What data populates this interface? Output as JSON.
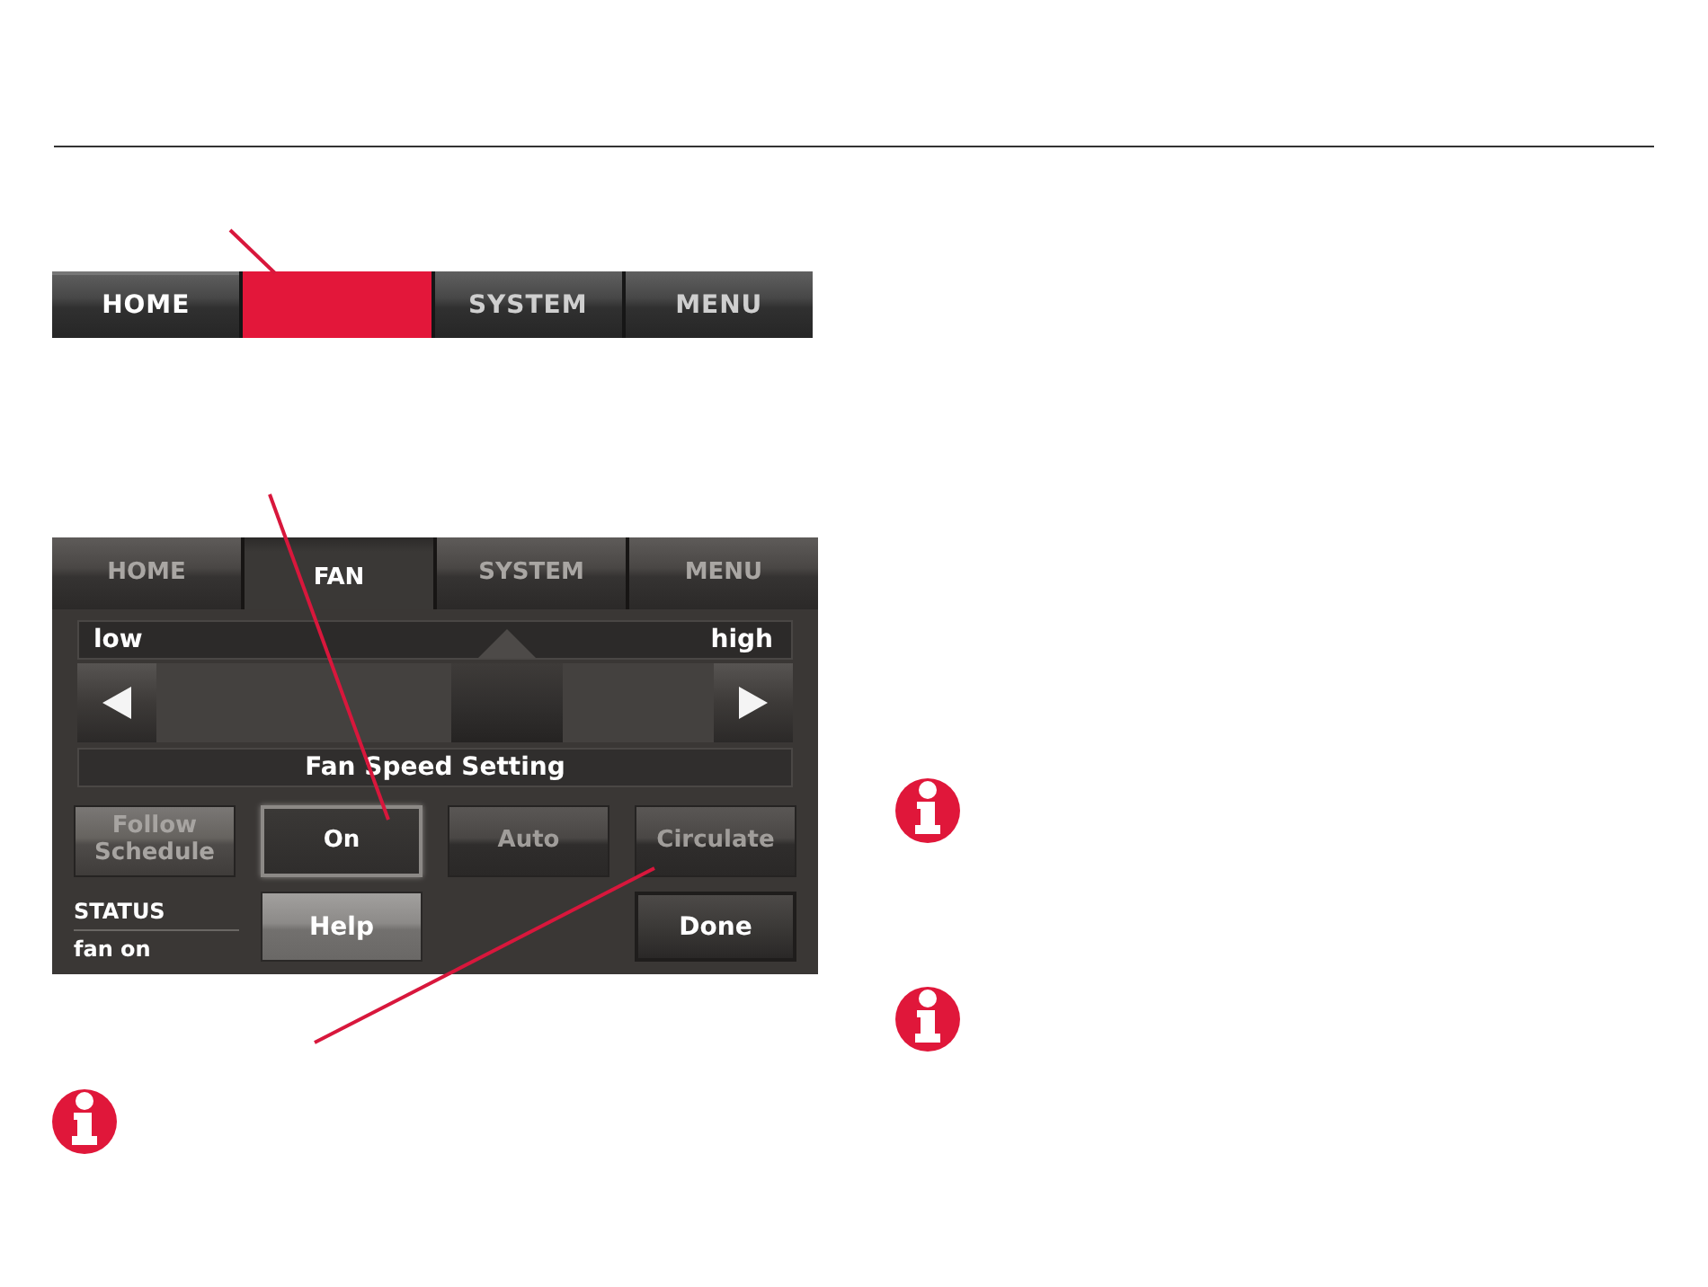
{
  "nav_bar": {
    "tabs": [
      {
        "label": "HOME",
        "selected": true,
        "highlighted": false
      },
      {
        "selected": false,
        "highlighted": true
      },
      {
        "label": "SYSTEM",
        "selected": false,
        "highlighted": false
      },
      {
        "label": "MENU",
        "selected": false,
        "highlighted": false
      }
    ]
  },
  "fan_screen": {
    "tabs": [
      {
        "label": "HOME",
        "selected": false
      },
      {
        "label": "FAN",
        "selected": true
      },
      {
        "label": "SYSTEM",
        "selected": false
      },
      {
        "label": "MENU",
        "selected": false
      }
    ],
    "speed_slider": {
      "min_label": "low",
      "max_label": "high",
      "level": 0.66,
      "caption": "Fan Speed Setting"
    },
    "mode_buttons": [
      {
        "label": "Follow Schedule",
        "selected": false,
        "disabled": true
      },
      {
        "label": "On",
        "selected": true,
        "disabled": false
      },
      {
        "label": "Auto",
        "selected": false,
        "disabled": false
      },
      {
        "label": "Circulate",
        "selected": false,
        "disabled": false
      }
    ],
    "status": {
      "heading": "STATUS",
      "value": "fan on"
    },
    "action_buttons": [
      {
        "label": "Help",
        "kind": "secondary"
      },
      {
        "label": "Done",
        "kind": "primary"
      }
    ]
  }
}
